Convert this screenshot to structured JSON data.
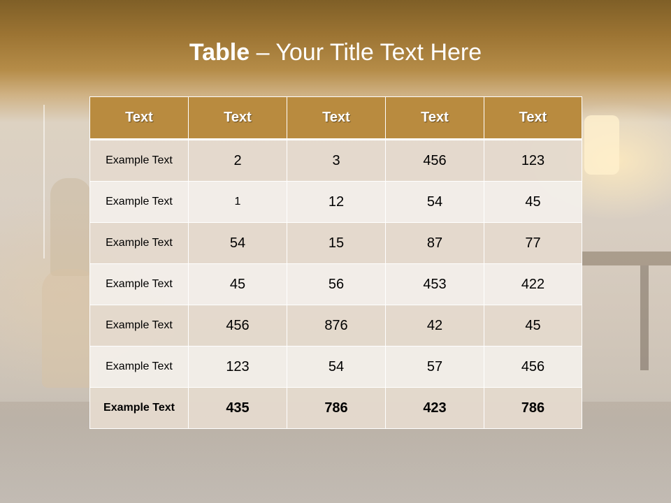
{
  "slide": {
    "title_bold": "Table",
    "title_rest": " – Your Title Text Here"
  },
  "table": {
    "headers": [
      "Text",
      "Text",
      "Text",
      "Text",
      "Text"
    ],
    "rows": [
      [
        "Example Text",
        "2",
        "3",
        "456",
        "123"
      ],
      [
        "Example Text",
        "1",
        "12",
        "54",
        "45"
      ],
      [
        "Example Text",
        "54",
        "15",
        "87",
        "77"
      ],
      [
        "Example Text",
        "45",
        "56",
        "453",
        "422"
      ],
      [
        "Example Text",
        "456",
        "876",
        "42",
        "45"
      ],
      [
        "Example Text",
        "123",
        "54",
        "57",
        "456"
      ]
    ],
    "total_row": [
      "Example Text",
      "435",
      "786",
      "423",
      "786"
    ]
  },
  "colors": {
    "header_fill": "#b98b3f",
    "title_text": "#ffffff",
    "row_dark": "#e4dacd",
    "row_light": "#f2eee9"
  }
}
